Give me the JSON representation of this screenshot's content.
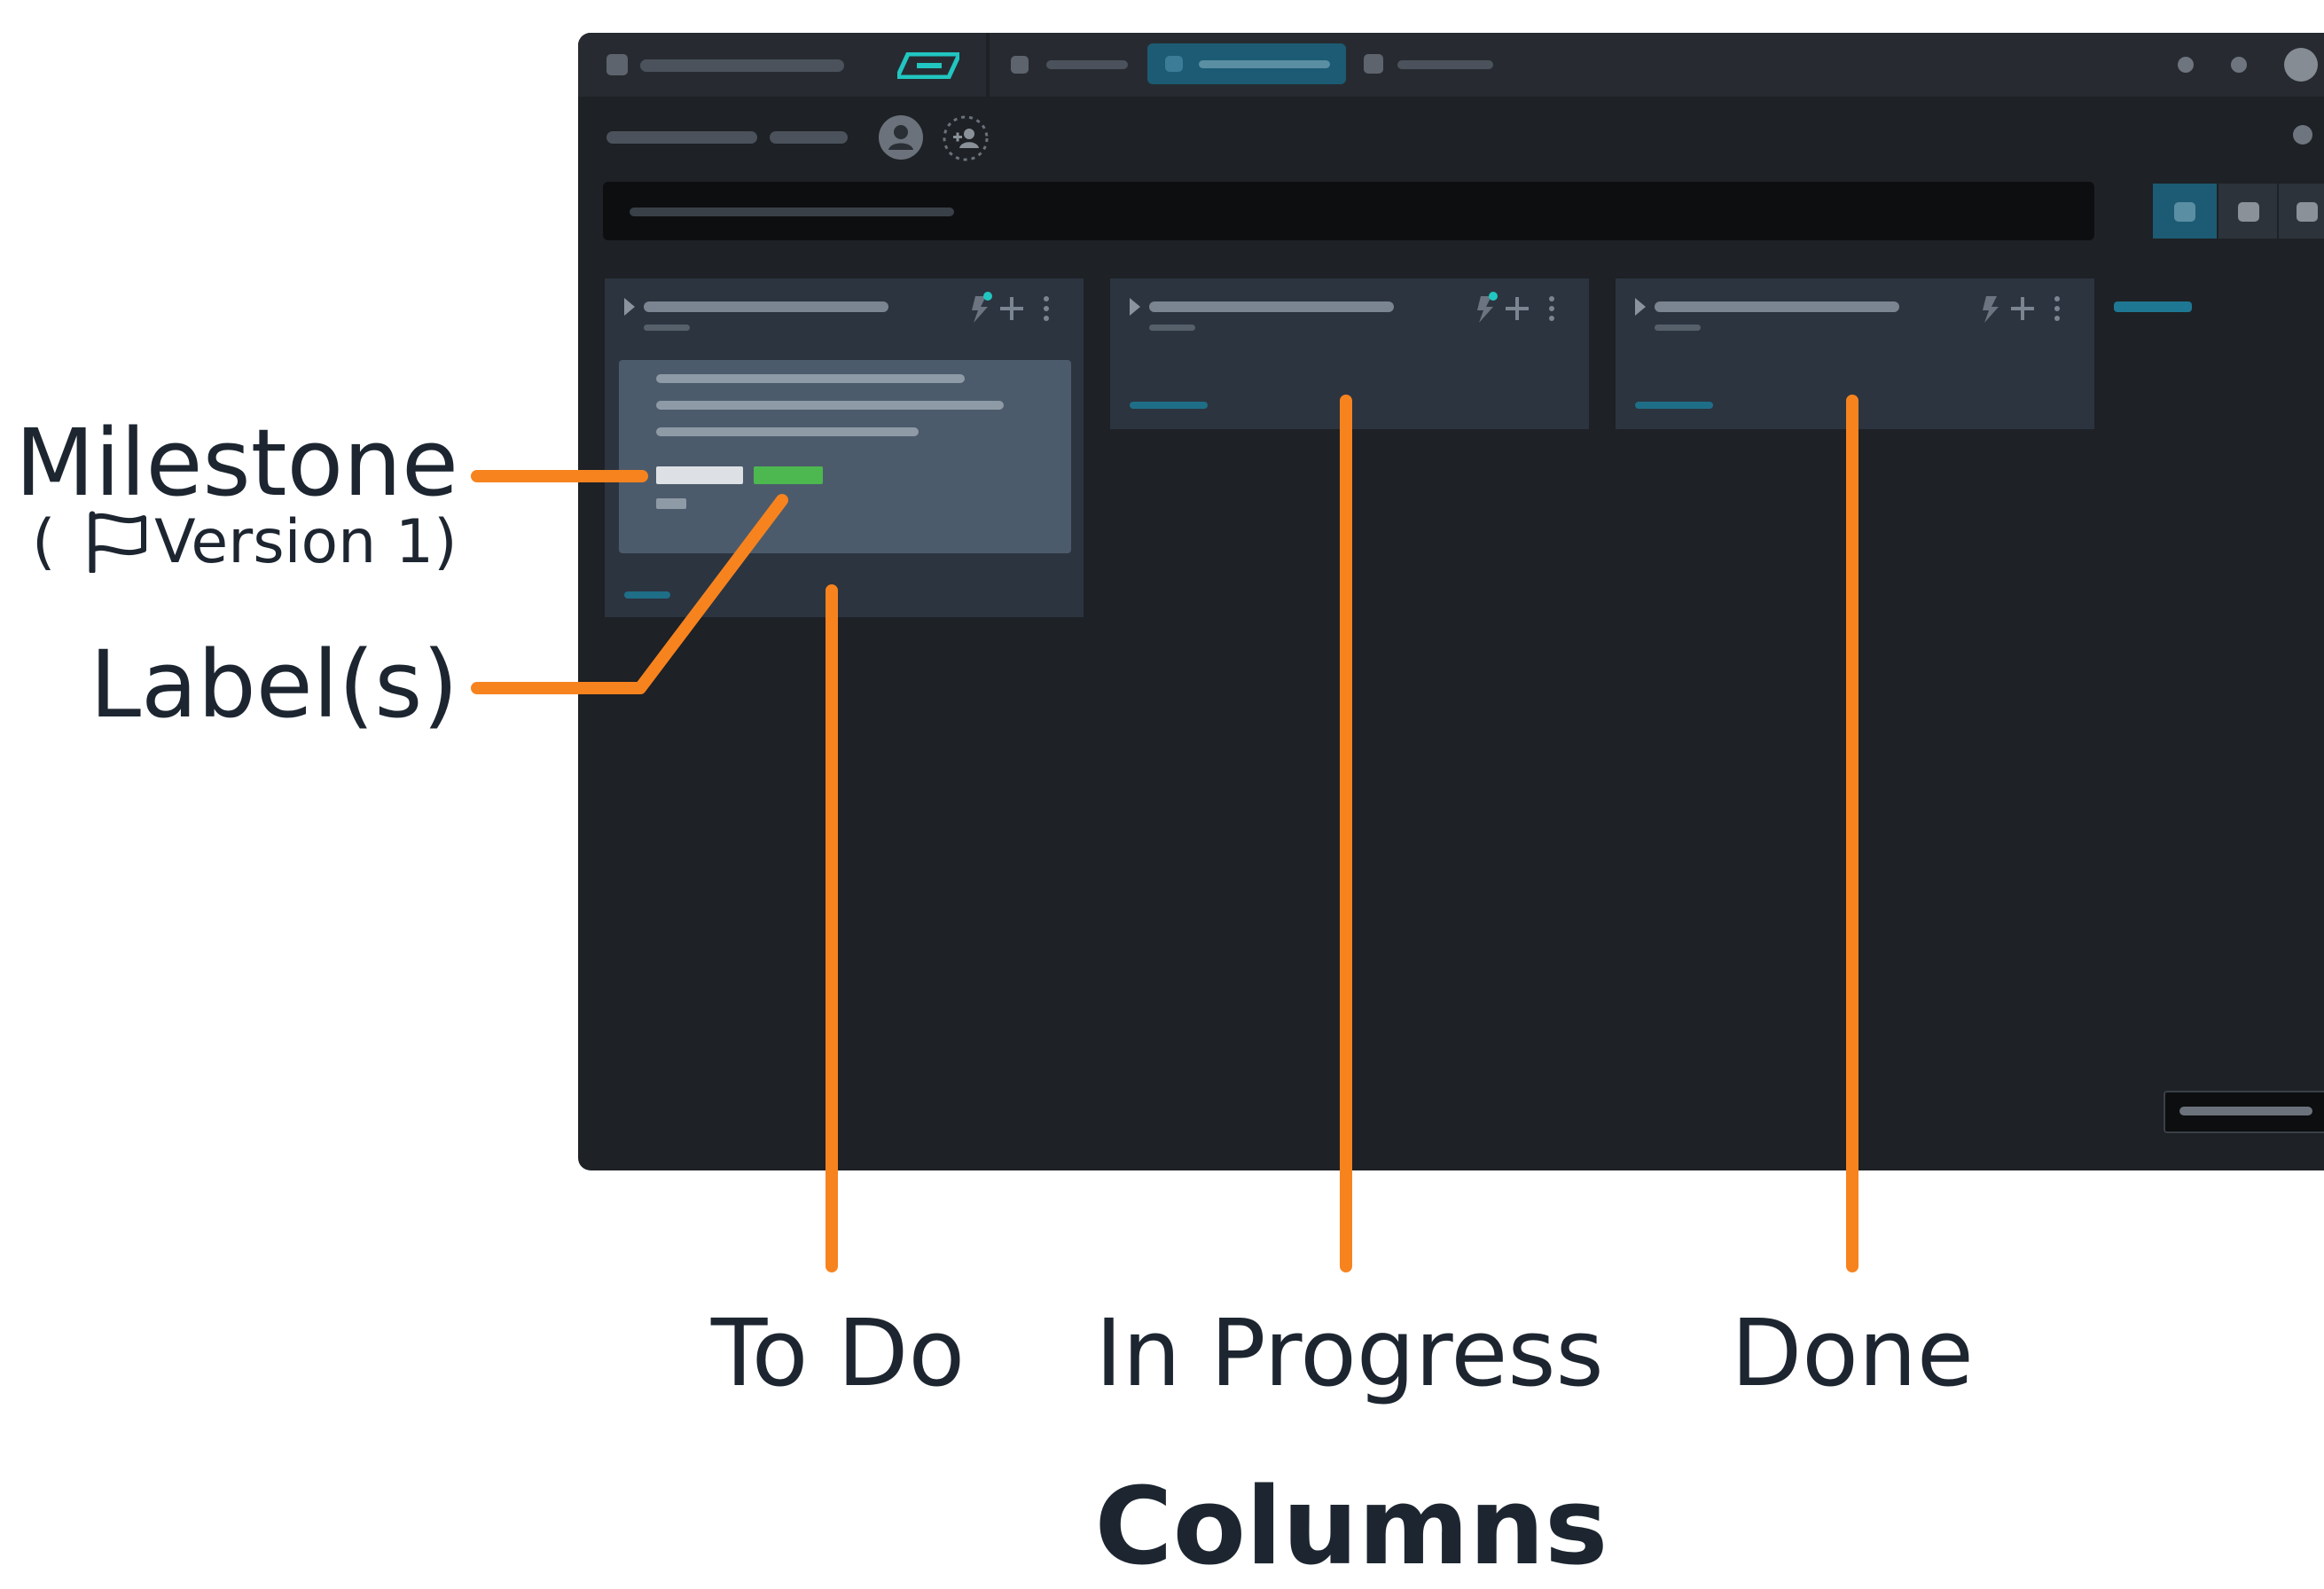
{
  "annotations": {
    "milestone_label": "Milestone",
    "milestone_sub_open": "(",
    "milestone_sub_text": "Version 1)",
    "labels_label": "Label(s)",
    "columns_title": "Columns"
  },
  "board": {
    "columns": [
      {
        "name": "To Do"
      },
      {
        "name": "In Progress"
      },
      {
        "name": "Done"
      }
    ]
  },
  "icons": {
    "milestone": "flag-icon",
    "add_member": "add-user-icon",
    "avatar": "user-avatar-icon",
    "automation": "lightning-icon",
    "add": "plus-icon",
    "more": "kebab-icon"
  },
  "colors": {
    "callout": "#f7831f",
    "label_green": "#4cb84f",
    "milestone_chip": "#dde1e5",
    "accent_teal": "#21c6c0",
    "active_tab": "#1c5b73"
  }
}
